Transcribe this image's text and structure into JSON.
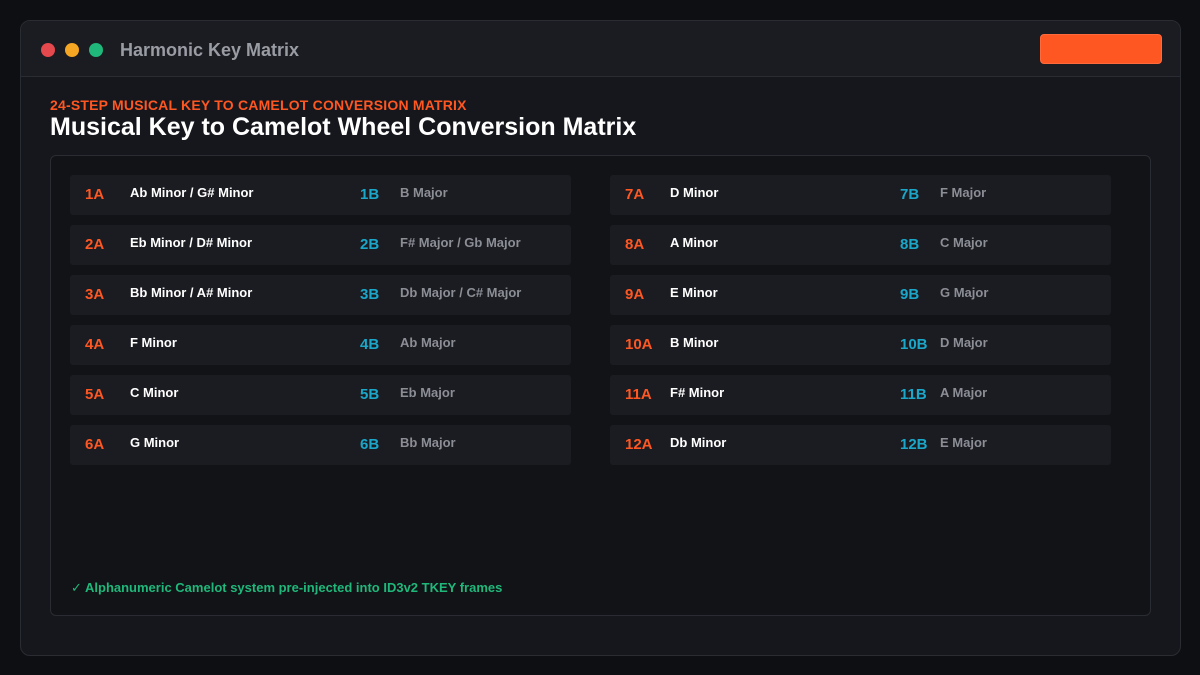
{
  "window": {
    "title": "Harmonic Key Matrix",
    "action_button_label": ""
  },
  "header": {
    "eyebrow": "24-STEP MUSICAL KEY TO CAMELOT CONVERSION MATRIX",
    "title": "Musical Key to Camelot Wheel Conversion Matrix"
  },
  "matrix": {
    "left": [
      {
        "minor_code": "1A",
        "minor_key": "Ab Minor / G# Minor",
        "major_code": "1B",
        "major_key": "B Major"
      },
      {
        "minor_code": "2A",
        "minor_key": "Eb Minor / D# Minor",
        "major_code": "2B",
        "major_key": "F# Major / Gb Major"
      },
      {
        "minor_code": "3A",
        "minor_key": "Bb Minor / A# Minor",
        "major_code": "3B",
        "major_key": "Db Major / C# Major"
      },
      {
        "minor_code": "4A",
        "minor_key": "F Minor",
        "major_code": "4B",
        "major_key": "Ab Major"
      },
      {
        "minor_code": "5A",
        "minor_key": "C Minor",
        "major_code": "5B",
        "major_key": "Eb Major"
      },
      {
        "minor_code": "6A",
        "minor_key": "G Minor",
        "major_code": "6B",
        "major_key": "Bb Major"
      }
    ],
    "right": [
      {
        "minor_code": "7A",
        "minor_key": "D Minor",
        "major_code": "7B",
        "major_key": "F Major"
      },
      {
        "minor_code": "8A",
        "minor_key": "A Minor",
        "major_code": "8B",
        "major_key": "C Major"
      },
      {
        "minor_code": "9A",
        "minor_key": "E Minor",
        "major_code": "9B",
        "major_key": "G Major"
      },
      {
        "minor_code": "10A",
        "minor_key": "B Minor",
        "major_code": "10B",
        "major_key": "D Major"
      },
      {
        "minor_code": "11A",
        "minor_key": "F# Minor",
        "major_code": "11B",
        "major_key": "A Major"
      },
      {
        "minor_code": "12A",
        "minor_key": "Db Minor",
        "major_code": "12B",
        "major_key": "E Major"
      }
    ]
  },
  "footer": {
    "icon": "check-icon",
    "note": "Alphanumeric Camelot system pre-injected into ID3v2 TKEY frames"
  },
  "colors": {
    "accent": "#ff5722",
    "major_code": "#1aa7c9",
    "success": "#1fb87a",
    "dot_red": "#e5484d",
    "dot_yellow": "#f5a623",
    "dot_green": "#1fb87a"
  }
}
